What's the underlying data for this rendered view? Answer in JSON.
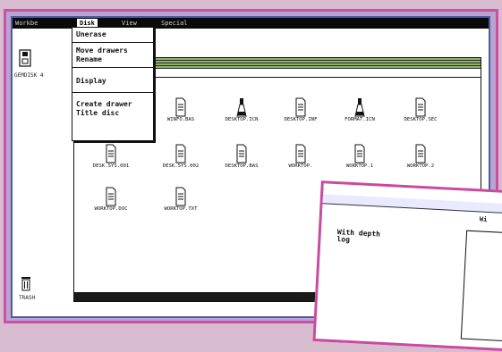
{
  "menubar": {
    "items": [
      "Workbe",
      "Disk",
      "View",
      "Special"
    ],
    "active": "Disk"
  },
  "desktop": {
    "drive_label": "GEMDISK 4",
    "trash_label": "TRASH"
  },
  "menu": {
    "items": [
      "Unerase",
      "Move drawers",
      "Rename",
      "Display",
      "Create drawer",
      "Title disc"
    ]
  },
  "window": {
    "files": [
      {
        "label": "WINFO.BAS",
        "icon": "doc-icon"
      },
      {
        "label": "DESKTOP.ICN",
        "icon": "tool-icon"
      },
      {
        "label": "DESKTOP.INF",
        "icon": "doc-icon"
      },
      {
        "label": "FORMAT.ICN",
        "icon": "tool-icon"
      },
      {
        "label": "DESKTOP.SEC",
        "icon": "doc-icon"
      },
      {
        "label": "DESK.SYS.001",
        "icon": "doc-icon"
      },
      {
        "label": "DESK.SYS.002",
        "icon": "doc-icon"
      },
      {
        "label": "DESKTOP.BAS",
        "icon": "doc-icon"
      },
      {
        "label": "WORKTOP.",
        "icon": "doc-icon"
      },
      {
        "label": "WORKTOP.1",
        "icon": "doc-icon"
      },
      {
        "label": "WORKTOP.2",
        "icon": "doc-icon"
      },
      {
        "label": "WORKTOP.DOC",
        "icon": "doc-icon"
      },
      {
        "label": "WORKTOP.TXT",
        "icon": "doc-icon"
      }
    ]
  },
  "overlay": {
    "text_line1": "With depth",
    "text_line2": "log",
    "heading": "Wi"
  },
  "colors": {
    "frame": "#cc4fa2",
    "screen_border": "#4d5aa0",
    "titlebar_stripe": "#8fb36a"
  }
}
